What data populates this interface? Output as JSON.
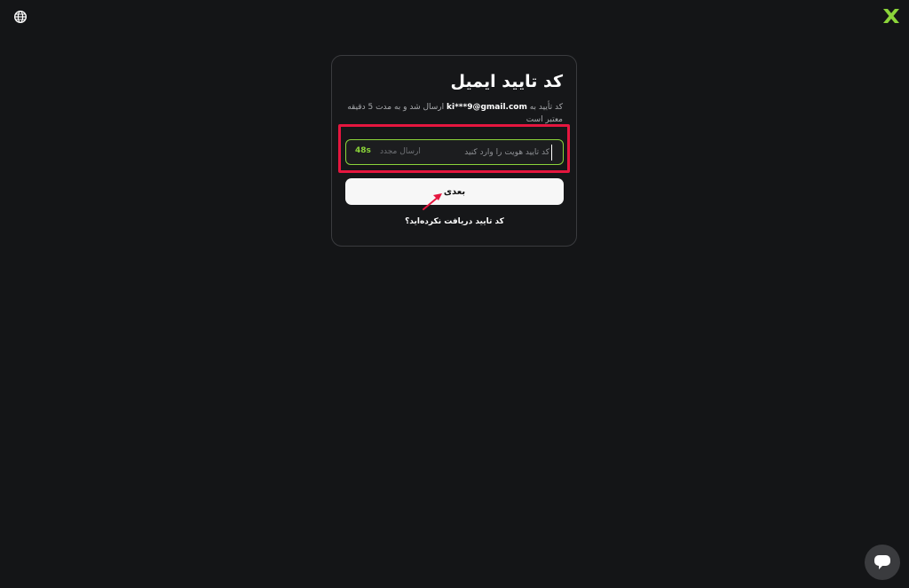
{
  "header": {
    "language_icon": "globe-icon",
    "logo_icon": "x-logo-icon",
    "logo_color": "#8bd43a"
  },
  "verification": {
    "title": "کد تایید ایمیل",
    "description_prefix": "کد تأیید به",
    "email": "ki***9@gmail.com",
    "description_suffix": "ارسال شد و به مدت 5 دقیقه معتبر است",
    "code_placeholder": "کد تأیید هویت را وارد کنید",
    "code_value": "",
    "resend_label": "ارسال مجدد",
    "timer": "48s",
    "next_label": "بعدی",
    "not_received_link": "کد تایید دریافت نکرده‌اید؟"
  },
  "colors": {
    "accent_green": "#8bd43a",
    "highlight_red": "#e5163f",
    "background": "#141517"
  },
  "support": {
    "chat_icon": "chat-bubble-icon"
  }
}
